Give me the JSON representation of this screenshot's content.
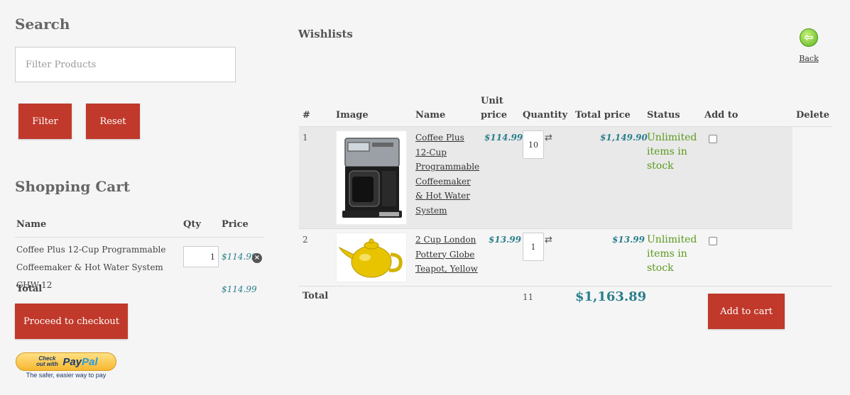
{
  "search": {
    "heading": "Search",
    "placeholder": "Filter Products",
    "filter_label": "Filter",
    "reset_label": "Reset"
  },
  "cart": {
    "heading": "Shopping Cart",
    "columns": {
      "name": "Name",
      "qty": "Qty",
      "price": "Price"
    },
    "items": [
      {
        "name": "Coffee Plus 12-Cup Programmable Coffeemaker & Hot Water System CHW-12",
        "qty": "1",
        "price": "$114.99"
      }
    ],
    "total_label": "Total",
    "total_value": "$114.99",
    "checkout_label": "Proceed to checkout"
  },
  "paypal": {
    "small_text": "Check out with",
    "logo_pay": "Pay",
    "logo_pal": "Pal",
    "tagline": "The safer, easier way to pay"
  },
  "wishlist": {
    "heading": "Wishlists",
    "back_label": "Back",
    "columns": {
      "num": "#",
      "image": "Image",
      "name": "Name",
      "unit_price": "Unit price",
      "quantity": "Quantity",
      "total_price": "Total price",
      "status": "Status",
      "add_to": "Add to",
      "delete": "Delete"
    },
    "rows": [
      {
        "num": "1",
        "name": "Coffee Plus 12-Cup Programmable Coffeemaker & Hot Water System",
        "unit_price": "$114.99",
        "quantity": "10",
        "total_price": "$1,149.90",
        "status": "Unlimited items in stock",
        "add_checked": false
      },
      {
        "num": "2",
        "name": "2 Cup London Pottery Globe Teapot, Yellow",
        "unit_price": "$13.99",
        "quantity": "1",
        "total_price": "$13.99",
        "status": "Unlimited items in stock",
        "add_checked": false
      }
    ],
    "total_label": "Total",
    "total_quantity": "11",
    "grand_total": "$1,163.89",
    "add_to_cart_label": "Add to cart"
  },
  "colors": {
    "accent_red": "#c0392b",
    "price_teal": "#2a7f8c",
    "status_green": "#5a9a1f"
  },
  "icons": [
    "back-arrow-icon",
    "remove-icon",
    "refresh-icon",
    "paypal-logo"
  ]
}
